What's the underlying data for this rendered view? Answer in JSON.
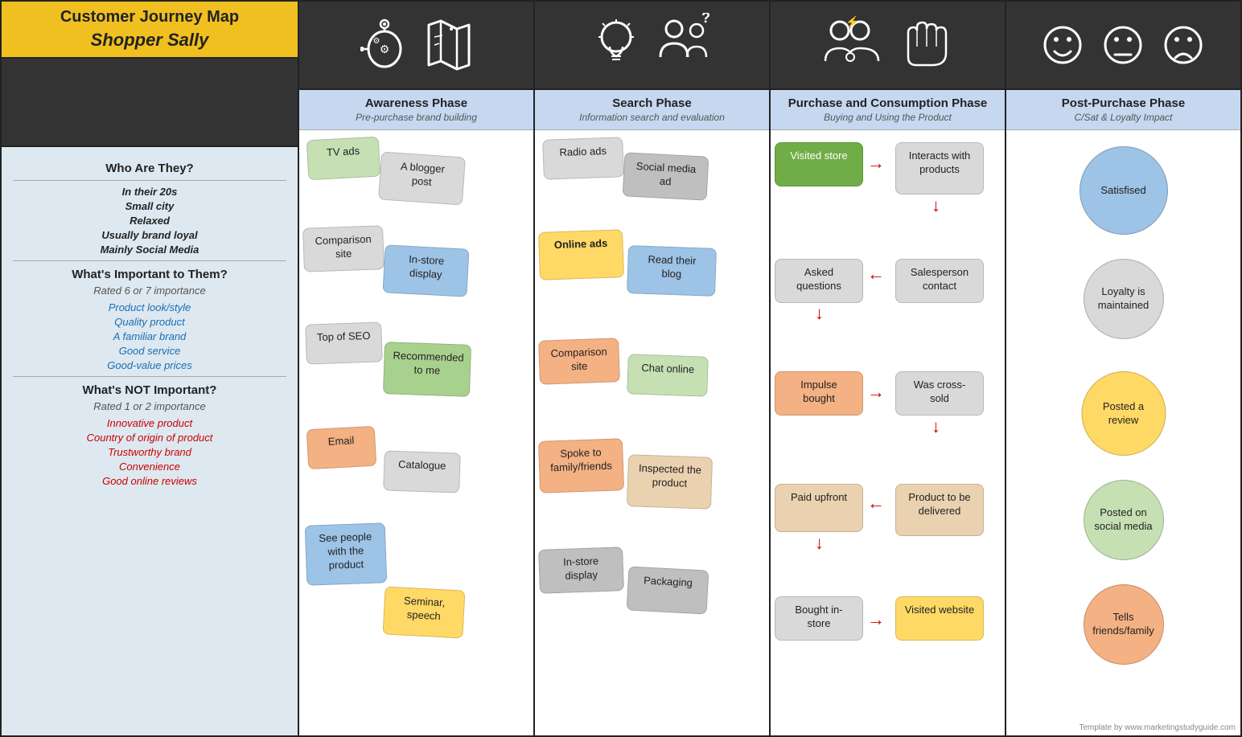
{
  "left": {
    "title": "Customer Journey Map",
    "subtitle": "Shopper Sally",
    "who": {
      "heading": "Who Are They?",
      "items": [
        "In their 20s",
        "Small city",
        "Relaxed",
        "Usually brand loyal",
        "Mainly Social Media"
      ]
    },
    "important": {
      "heading": "What's Important to Them?",
      "subheading": "Rated 6 or 7 importance",
      "items": [
        "Product look/style",
        "Quality product",
        "A familiar brand",
        "Good service",
        "Good-value prices"
      ]
    },
    "notImportant": {
      "heading": "What's NOT Important?",
      "subheading": "Rated 1 or 2 importance",
      "items": [
        "Innovative product",
        "Country of origin of product",
        "Trustworthy brand",
        "Convenience",
        "Good online reviews"
      ]
    }
  },
  "phases": [
    {
      "title": "Awareness Phase",
      "subtitle": "Pre-purchase brand building",
      "icons": [
        "brain-gear-icon",
        "map-icon"
      ]
    },
    {
      "title": "Search Phase",
      "subtitle": "Information search and evaluation",
      "icons": [
        "lightbulb-icon",
        "people-question-icon"
      ]
    },
    {
      "title": "Purchase and Consumption Phase",
      "subtitle": "Buying and Using the Product",
      "icons": [
        "group-lightning-icon",
        "hand-icon"
      ]
    },
    {
      "title": "Post-Purchase Phase",
      "subtitle": "C/Sat & Loyalty Impact",
      "icons": [
        "happy-face-icon",
        "neutral-face-icon",
        "sad-face-icon"
      ]
    }
  ],
  "awarenessCards": [
    {
      "label": "TV ads",
      "color": "green"
    },
    {
      "label": "A blogger post",
      "color": "gray"
    },
    {
      "label": "Comparison site",
      "color": "gray"
    },
    {
      "label": "In-store display",
      "color": "blue"
    },
    {
      "label": "Top of SEO",
      "color": "gray"
    },
    {
      "label": "Recommended to me",
      "color": "green2"
    },
    {
      "label": "Email",
      "color": "salmon"
    },
    {
      "label": "Catalogue",
      "color": "gray"
    },
    {
      "label": "See people with the product",
      "color": "blue"
    },
    {
      "label": "Seminar, speech",
      "color": "yellow"
    }
  ],
  "searchCards": [
    {
      "label": "Radio ads",
      "color": "gray"
    },
    {
      "label": "Social media ad",
      "color": "gray2"
    },
    {
      "label": "Online ads",
      "color": "yellow"
    },
    {
      "label": "Read their blog",
      "color": "ltblue"
    },
    {
      "label": "Comparison site",
      "color": "peach"
    },
    {
      "label": "Chat online",
      "color": "ltgreen"
    },
    {
      "label": "Spoke to family/friends",
      "color": "peach"
    },
    {
      "label": "Inspected the product",
      "color": "tan"
    },
    {
      "label": "In-store display",
      "color": "gray2"
    },
    {
      "label": "Packaging",
      "color": "gray2"
    }
  ],
  "purchaseItems": [
    {
      "label": "Visited store",
      "color": "green3",
      "type": "left"
    },
    {
      "label": "Interacts with products",
      "color": "lt2",
      "type": "right"
    },
    {
      "label": "Asked questions",
      "color": "lt2",
      "type": "left"
    },
    {
      "label": "Salesperson contact",
      "color": "lt2",
      "type": "right"
    },
    {
      "label": "Impulse bought",
      "color": "salmon2",
      "type": "left"
    },
    {
      "label": "Was cross-sold",
      "color": "lt2",
      "type": "right"
    },
    {
      "label": "Paid upfront",
      "color": "tan2",
      "type": "left"
    },
    {
      "label": "Product to be delivered",
      "color": "tan2",
      "type": "right"
    },
    {
      "label": "Bought in-store",
      "color": "lt2",
      "type": "left"
    },
    {
      "label": "Visited website",
      "color": "yellow2",
      "type": "right"
    }
  ],
  "postPurchaseItems": [
    {
      "label": "Satisfised",
      "color": "blue",
      "size": 110
    },
    {
      "label": "Loyalty is maintained",
      "color": "gray",
      "size": 100
    },
    {
      "label": "Posted a review",
      "color": "yellow",
      "size": 105
    },
    {
      "label": "Posted on social media",
      "color": "green",
      "size": 95
    },
    {
      "label": "Tells friends/family",
      "color": "salmon",
      "size": 100
    }
  ],
  "templateCredit": "Template by www.marketingstudyguide.com"
}
